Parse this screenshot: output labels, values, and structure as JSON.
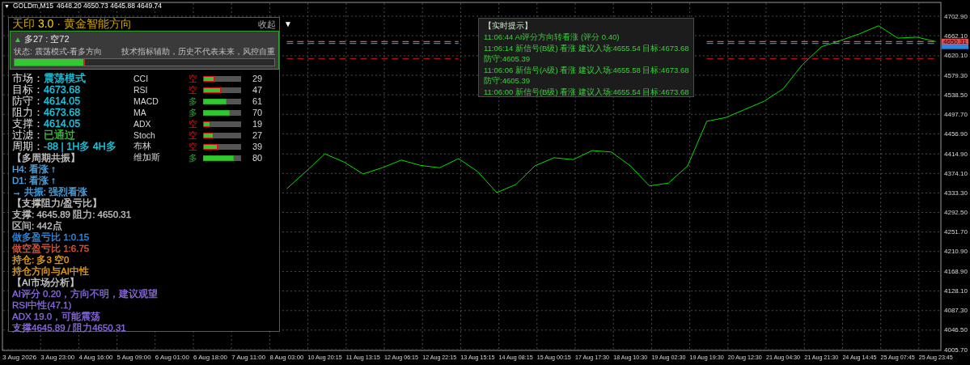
{
  "header": {
    "menu": "▼",
    "symbol": "GOLDm,M15",
    "ohlc": "4648.20 4650.73 4645.88 4649.74"
  },
  "panel": {
    "title": "天印 **3.0** · 黄金智能方向",
    "collapse": "收起",
    "toggle": "▼",
    "score": {
      "icon": "▲",
      "text": "多27 : 空72",
      "status": "状态: 震荡模式-看多方向",
      "disclaimer": "技术指标辅助，历史不代表未来，风控自重",
      "level": 0.27
    },
    "fields": [
      {
        "label": "市场：",
        "value": "震荡模式",
        "color": "#1ec8e0"
      },
      {
        "label": "目标：",
        "value": "4673.68",
        "color": "#1ec8e0"
      },
      {
        "label": "防守：",
        "value": "4614.05",
        "color": "#1ec8e0"
      },
      {
        "label": "阻力：",
        "value": "4673.68",
        "color": "#1ec8e0"
      },
      {
        "label": "支撑：",
        "value": "4614.05",
        "color": "#1ec8e0"
      },
      {
        "label": "过滤：",
        "value": "已通过",
        "color": "#32c832"
      },
      {
        "label": "周期：",
        "value": "-88 | 1H多 4H多",
        "color": "#1ec8e0"
      }
    ],
    "indicators": [
      {
        "name": "CCI",
        "direction": "空",
        "color": "#e01010",
        "level": 0.29,
        "value": "29"
      },
      {
        "name": "RSI",
        "direction": "空",
        "color": "#e01010",
        "level": 0.47,
        "value": "47"
      },
      {
        "name": "MACD",
        "direction": "多",
        "color": "#20b020",
        "level": 0.61,
        "value": "61"
      },
      {
        "name": "MA",
        "direction": "多",
        "color": "#20b020",
        "level": 0.7,
        "value": "70"
      },
      {
        "name": "ADX",
        "direction": "空",
        "color": "#e01010",
        "level": 0.19,
        "value": "19"
      },
      {
        "name": "Stoch",
        "direction": "空",
        "color": "#e01010",
        "level": 0.27,
        "value": "27"
      },
      {
        "name": "布林",
        "direction": "空",
        "color": "#e01010",
        "level": 0.39,
        "value": "39"
      },
      {
        "name": "维加斯",
        "direction": "多",
        "color": "#20b020",
        "level": 0.8,
        "value": "80"
      }
    ],
    "lines": [
      {
        "text": "【多周期共振】",
        "color": "#c8c8c8"
      },
      {
        "text": "H4: 看涨 ↑",
        "color": "#4aa8e8"
      },
      {
        "text": "D1: 看涨 ↑",
        "color": "#4aa8e8"
      },
      {
        "text": "→ 共振: 强烈看涨",
        "color": "#4aa8e8"
      },
      {
        "text": "【支撑阻力/盈亏比】",
        "color": "#c8c8c8"
      },
      {
        "text": "支撑: 4645.89  阻力: 4650.31",
        "color": "#c0c0c0"
      },
      {
        "text": "区间: 442点",
        "color": "#c0c0c0"
      },
      {
        "text": "做多盈亏比 1:0.15",
        "color": "#2f8fe6"
      },
      {
        "text": "做空盈亏比 1:6.75",
        "color": "#e05a3a"
      },
      {
        "text": "持仓: 多3 空0",
        "color": "#e8a010"
      },
      {
        "text": "持仓方向与AI中性",
        "color": "#e8a010"
      },
      {
        "text": "【AI市场分析】",
        "color": "#c8c8c8"
      },
      {
        "text": "AI评分 0.20，方向不明，建议观望",
        "color": "#8a6ae0"
      },
      {
        "text": "RSI中性(47.1)",
        "color": "#8a6ae0"
      },
      {
        "text": "ADX 19.0，可能震荡",
        "color": "#8a6ae0"
      },
      {
        "text": "支撑4645.89 / 阻力4650.31",
        "color": "#8a6ae0"
      }
    ]
  },
  "alerts": {
    "title": "【实时提示】",
    "lines": [
      "11:06:44 AI评分方向转看涨 (评分 0.40)",
      "11:06:14 新信号(B级) 看涨 建议入场:4655.54 目标:4673.68",
      "防守:4605.39",
      "11:06:06 新信号(A级) 看涨 建议入场:4655.58 目标:4673.68",
      "防守:4605.39",
      "11:06:00 新信号(B级) 看涨 建议入场:4655.54 目标:4673.68"
    ]
  },
  "chart_data": {
    "type": "line",
    "grid": true,
    "categories": [
      null,
      "3 Aug 2026",
      null,
      "3 Aug 23:00",
      null,
      "4 Aug 16:00",
      null,
      "5 Aug 09:00",
      null,
      "6 Aug 01:00",
      null,
      "6 Aug 18:00",
      null,
      "7 Aug 11:00",
      null,
      "8 Aug 03:00",
      null,
      "10 Aug 20:15",
      null,
      "11 Aug 13:15",
      null,
      "12 Aug 06:15",
      null,
      "12 Aug 22:15",
      null,
      "13 Aug 15:15",
      null,
      "14 Aug 08:15",
      null,
      "15 Aug 00:15",
      null,
      "17 Aug 17:30",
      null,
      "18 Aug 10:30",
      null,
      "19 Aug 02:30",
      null,
      "19 Aug 19:30",
      null,
      "20 Aug 12:30",
      null,
      "21 Aug 04:30",
      null,
      "21 Aug 21:30",
      null,
      "24 Aug 14:45",
      null,
      "25 Aug 07:45",
      null,
      "25 Aug 23:45"
    ],
    "series": [
      {
        "color": "#00e000",
        "line_style": "solid",
        "values": [
          null,
          null,
          null,
          null,
          null,
          null,
          null,
          null,
          null,
          null,
          null,
          null,
          null,
          null,
          null,
          4342,
          4378,
          4415,
          4398,
          4373,
          4386,
          4402,
          4391,
          4386,
          4405,
          4378,
          4334,
          4351,
          4390,
          4407,
          4403,
          4422,
          4419,
          4390,
          4348,
          4354,
          4390,
          4483,
          4491,
          4508,
          4525,
          4551,
          4601,
          4639,
          4652,
          4666,
          4683,
          4657,
          4659,
          4650
        ]
      },
      {
        "color": "#e05050",
        "line_style": "dashed",
        "values": [
          null,
          null,
          null,
          null,
          null,
          null,
          null,
          null,
          null,
          null,
          null,
          null,
          null,
          null,
          null,
          4650,
          4650,
          4650,
          4650,
          4650,
          4650,
          4650,
          4650,
          4650,
          4650,
          null,
          null,
          null,
          null,
          null,
          null,
          null,
          null,
          null,
          null,
          null,
          null,
          4650,
          4650,
          4650,
          4650,
          4650,
          4650,
          4650,
          4650,
          4650,
          4650,
          4650,
          4650,
          4650
        ]
      },
      {
        "color": "#2e86de",
        "line_style": "dashed",
        "values": [
          null,
          null,
          null,
          null,
          null,
          null,
          null,
          null,
          null,
          null,
          null,
          null,
          null,
          null,
          null,
          4646,
          4646,
          4646,
          4646,
          4646,
          4646,
          4646,
          4646,
          4646,
          4646,
          null,
          null,
          null,
          null,
          null,
          null,
          null,
          null,
          null,
          null,
          null,
          null,
          4646,
          4646,
          4646,
          4646,
          4646,
          4646,
          4646,
          4646,
          4646,
          4646,
          4646,
          4646,
          4646
        ]
      },
      {
        "color": "#b01010",
        "line_style": "dashed",
        "values": [
          null,
          null,
          null,
          null,
          null,
          null,
          null,
          null,
          null,
          null,
          null,
          null,
          null,
          null,
          null,
          4614,
          4614,
          4614,
          4614,
          4614,
          4614,
          4614,
          4614,
          4614,
          4614,
          null,
          null,
          null,
          null,
          null,
          null,
          null,
          null,
          null,
          null,
          null,
          null,
          4614,
          4614,
          4614,
          4614,
          4614,
          4614,
          4614,
          4614,
          4614,
          4614,
          4614,
          4614,
          4614
        ]
      }
    ],
    "ylim": [
      4005.7,
      4702.9
    ],
    "yticks": [
      {
        "value": 4702.9,
        "label": "4702.90"
      },
      {
        "value": 4662.1,
        "label": "4662.10"
      },
      {
        "value": 4620.1,
        "label": "4620.10"
      },
      {
        "value": 4579.3,
        "label": "4579.30"
      },
      {
        "value": 4538.5,
        "label": "4538.50"
      },
      {
        "value": 4497.7,
        "label": "4497.70"
      },
      {
        "value": 4456.9,
        "label": "4456.90"
      },
      {
        "value": 4414.9,
        "label": "4414.90"
      },
      {
        "value": 4374.1,
        "label": "4374.10"
      },
      {
        "value": 4333.3,
        "label": "4333.30"
      },
      {
        "value": 4292.5,
        "label": "4292.50"
      },
      {
        "value": 4251.7,
        "label": "4251.70"
      },
      {
        "value": 4210.9,
        "label": "4210.90"
      },
      {
        "value": 4168.9,
        "label": "4168.90"
      },
      {
        "value": 4128.1,
        "label": "4128.10"
      },
      {
        "value": 4087.3,
        "label": "4087.30"
      },
      {
        "value": 4046.5,
        "label": "4046.50"
      },
      {
        "value": 4005.7,
        "label": "4005.70"
      }
    ]
  },
  "price_tags": [
    {
      "label": "4650.31",
      "color": "#e05050"
    },
    {
      "color": "#2e86de"
    }
  ]
}
